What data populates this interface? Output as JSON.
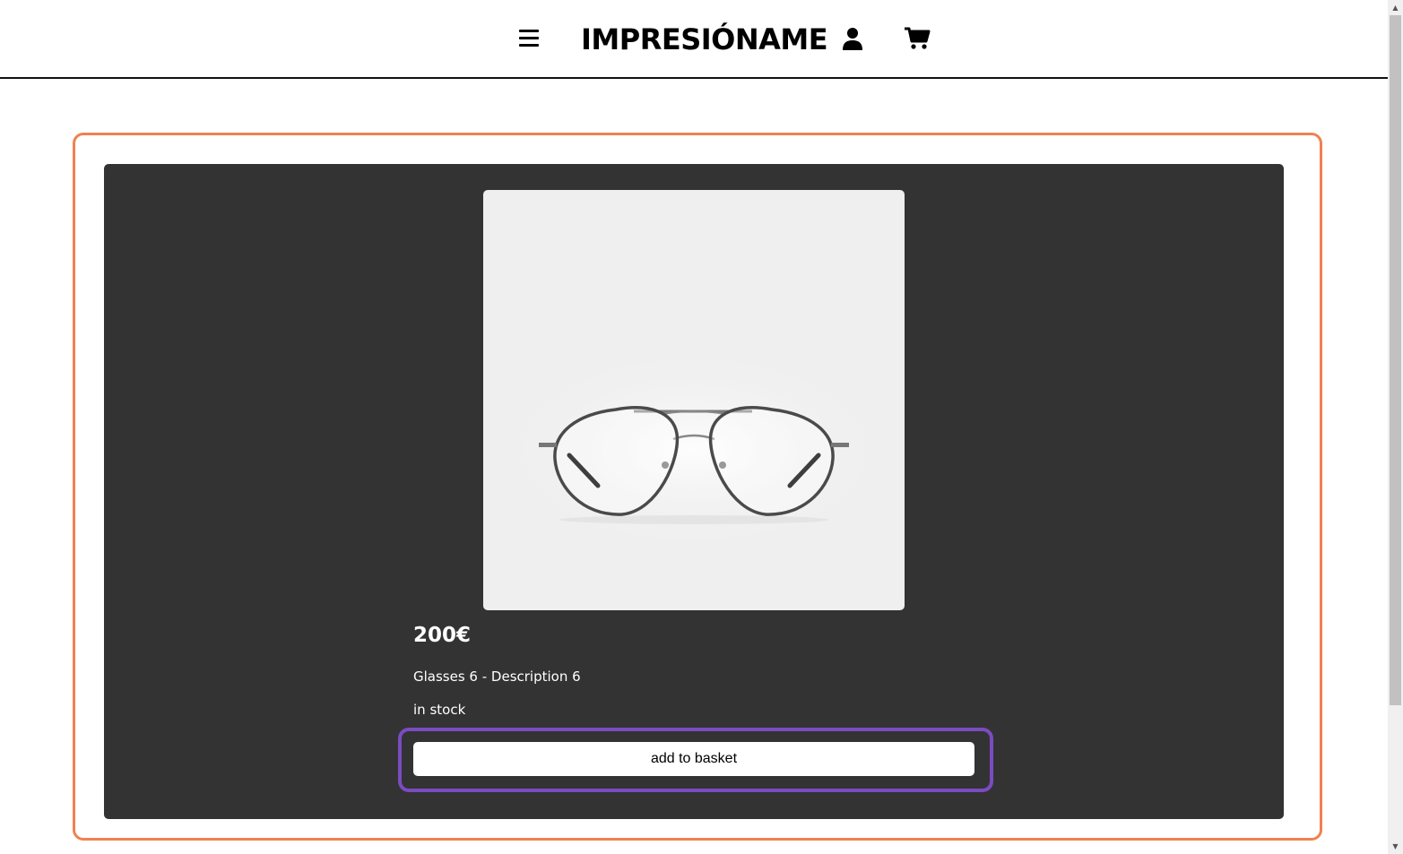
{
  "header": {
    "brand": "IMPRESIÓNAME",
    "menu_icon": "hamburger-menu-icon",
    "user_icon": "user-icon",
    "cart_icon": "shopping-cart-icon"
  },
  "product": {
    "image_alt": "aviator glasses",
    "price": "200€",
    "description": "Glasses 6 - Description 6",
    "stock": "in stock",
    "add_button_label": "add to basket"
  },
  "colors": {
    "page_background": "#ffffff",
    "card_background": "#333333",
    "outer_highlight": "#f08150",
    "button_highlight": "#7b4bc1",
    "image_background": "#efefef"
  }
}
